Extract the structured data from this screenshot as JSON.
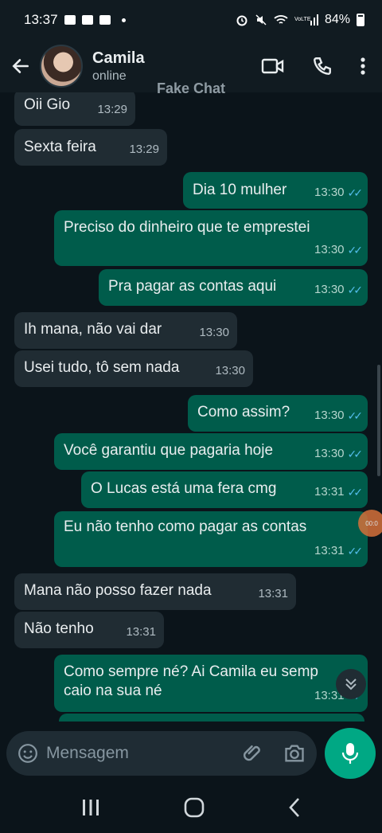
{
  "status_bar": {
    "time": "13:37",
    "battery": "84%"
  },
  "header": {
    "contact_name": "Camila",
    "contact_status": "online"
  },
  "watermark": "Fake Chat",
  "messages": [
    {
      "dir": "in",
      "text": "Oii Gio",
      "time": "13:29"
    },
    {
      "dir": "in",
      "text": "Sexta feira",
      "time": "13:29"
    },
    {
      "dir": "out",
      "text": "Dia 10 mulher",
      "time": "13:30"
    },
    {
      "dir": "out",
      "text": "Preciso do dinheiro que te emprestei",
      "time": "13:30"
    },
    {
      "dir": "out",
      "text": "Pra pagar as contas aqui",
      "time": "13:30"
    },
    {
      "dir": "in",
      "text": "Ih mana, não vai dar",
      "time": "13:30"
    },
    {
      "dir": "in",
      "text": "Usei tudo, tô sem nada",
      "time": "13:30"
    },
    {
      "dir": "out",
      "text": "Como assim?",
      "time": "13:30"
    },
    {
      "dir": "out",
      "text": "Você garantiu que pagaria hoje",
      "time": "13:30"
    },
    {
      "dir": "out",
      "text": "O Lucas está uma fera cmg",
      "time": "13:31"
    },
    {
      "dir": "out",
      "text": "Eu não tenho como pagar as contas",
      "time": "13:31"
    },
    {
      "dir": "in",
      "text": "Mana não posso fazer nada",
      "time": "13:31"
    },
    {
      "dir": "in",
      "text": "Não tenho",
      "time": "13:31"
    },
    {
      "dir": "out",
      "text": "Como sempre né? Ai Camila eu semp",
      "text2": "caio na sua né",
      "time": "13:31"
    }
  ],
  "overlay_timer": "00:0",
  "input": {
    "placeholder": "Mensagem"
  },
  "colors": {
    "incoming": "#202c33",
    "outgoing": "#005c4b",
    "accent": "#00a884",
    "ticks": "#53bdeb"
  }
}
